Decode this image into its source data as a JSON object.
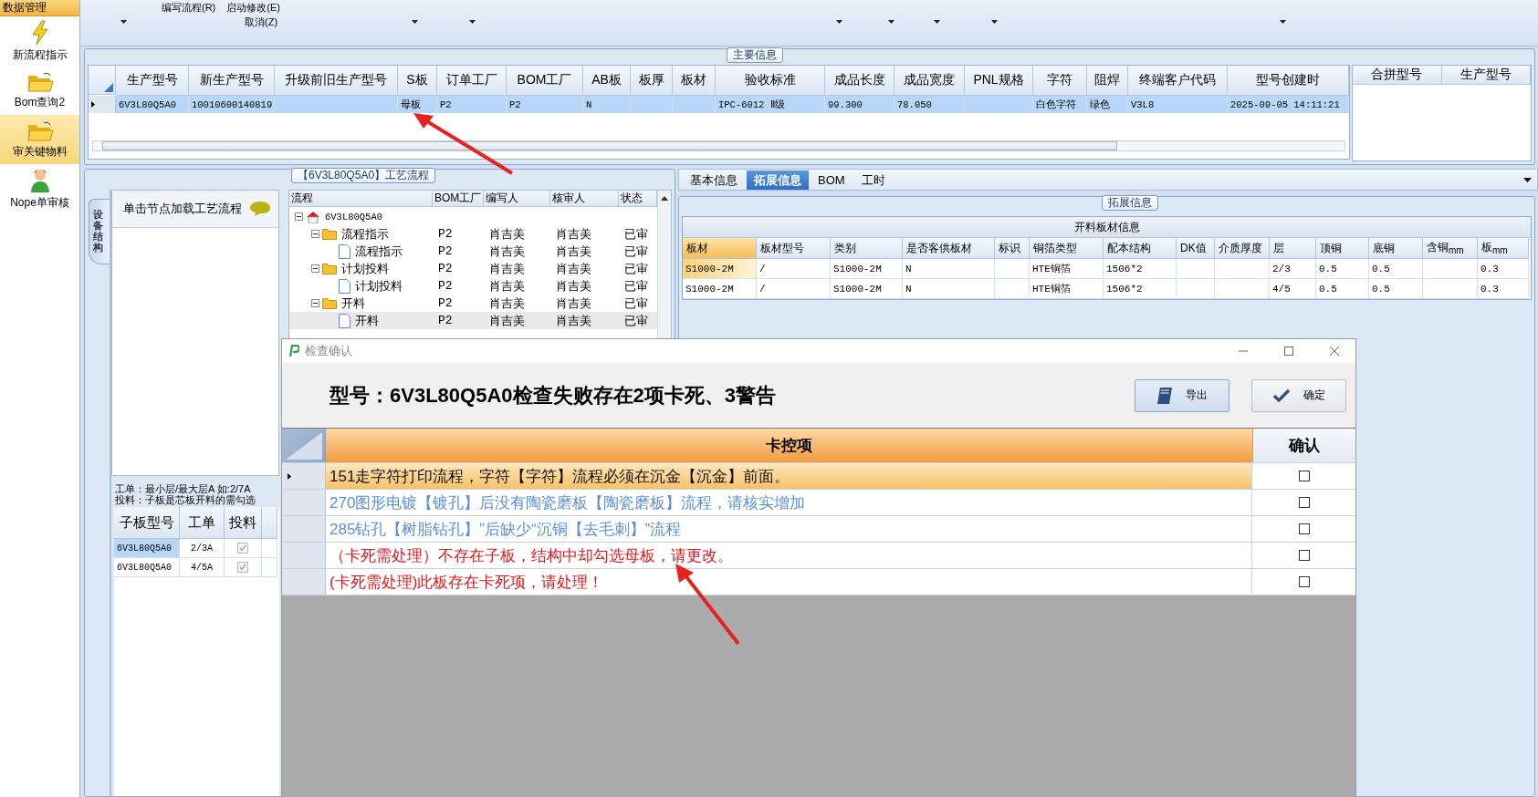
{
  "sidebar": {
    "header": "数据管理",
    "items": [
      {
        "label": "新流程指示",
        "kind": "lightning",
        "selected": false
      },
      {
        "label": "Bom查询2",
        "kind": "folder",
        "selected": false
      },
      {
        "label": "审关键物料",
        "kind": "folder",
        "selected": true
      },
      {
        "label": "Nope单审核",
        "kind": "person",
        "selected": false
      }
    ]
  },
  "ribbon": {
    "commands": [
      "编写流程(R)",
      "启动修改(E)",
      "取消(Z)"
    ]
  },
  "main_info": {
    "title": "主要信息",
    "columns": [
      "生产型号",
      "新生产型号",
      "升级前旧生产型号",
      "S板",
      "订单工厂",
      "BOM工厂",
      "AB板",
      "板厚",
      "板材",
      "验收标准",
      "成品长度",
      "成品宽度",
      "PNL规格",
      "字符",
      "阻焊",
      "终端客户代码",
      "型号创建时"
    ],
    "rows": [
      {
        "selected": true,
        "cells": [
          "6V3L80Q5A0",
          "10010600140819",
          null,
          "母板",
          "P2",
          "P2",
          "N",
          null,
          null,
          "IPC-6012 Ⅱ级",
          "99.300",
          "78.050",
          null,
          "白色字符",
          "绿色",
          "V3L8",
          "2025-09-05 14:11:21"
        ]
      }
    ],
    "side_columns": [
      "合拼型号",
      "生产型号"
    ]
  },
  "process": {
    "title": "【6V3L80Q5A0】工艺流程",
    "side_tab": "设备结构",
    "hint": "单击节点加载工艺流程",
    "columns": [
      "流程",
      "BOM工厂",
      "编写人",
      "核审人",
      "状态"
    ],
    "tree": [
      {
        "label": "6V3L80Q5A0",
        "kind": "root",
        "expanded": true,
        "selected": false,
        "children": [
          {
            "label": "流程指示",
            "kind": "folder",
            "expanded": true,
            "selected": false,
            "cells": [
              "P2",
              "肖吉美",
              "肖吉美",
              "已审"
            ],
            "children": [
              {
                "label": "流程指示",
                "kind": "doc",
                "selected": false,
                "cells": [
                  "P2",
                  "肖吉美",
                  "肖吉美",
                  "已审"
                ]
              }
            ]
          },
          {
            "label": "计划投料",
            "kind": "folder",
            "expanded": true,
            "selected": false,
            "cells": [
              "P2",
              "肖吉美",
              "肖吉美",
              "已审"
            ],
            "children": [
              {
                "label": "计划投料",
                "kind": "doc",
                "selected": false,
                "cells": [
                  "P2",
                  "肖吉美",
                  "肖吉美",
                  "已审"
                ]
              }
            ]
          },
          {
            "label": "开料",
            "kind": "folder",
            "expanded": true,
            "selected": false,
            "cells": [
              "P2",
              "肖吉美",
              "肖吉美",
              "已审"
            ],
            "children": [
              {
                "label": "开料",
                "kind": "doc",
                "selected": true,
                "cells": [
                  "P2",
                  "肖吉美",
                  "肖吉美",
                  "已审"
                ]
              }
            ]
          }
        ]
      }
    ],
    "notes": [
      "工单：最小层/最大层A 如:2/7A",
      "投料：子板是芯板开料的需勾选"
    ],
    "sub_boards": {
      "columns": [
        "子板型号",
        "工单",
        "投料"
      ],
      "rows": [
        {
          "selected": true,
          "cells": [
            "6V3L80Q5A0",
            "2/3A"
          ],
          "checked": true
        },
        {
          "selected": false,
          "cells": [
            "6V3L80Q5A0",
            "4/5A"
          ],
          "checked": true
        }
      ]
    }
  },
  "detail": {
    "tabs": [
      {
        "label": "基本信息",
        "selected": false
      },
      {
        "label": "拓展信息",
        "selected": true
      },
      {
        "label": "BOM",
        "selected": false
      },
      {
        "label": "工时",
        "selected": false
      }
    ],
    "group_title": "拓展信息",
    "caption": "开料板材信息",
    "columns": [
      "板材",
      "板材型号",
      "类别",
      "是否客供板材",
      "标识",
      "铜箔类型",
      "配本结构",
      "DK值",
      "介质厚度",
      "层",
      "顶铜",
      "底铜",
      "含铜$_{mm}$",
      "板$_{mm}$"
    ],
    "rows": [
      {
        "selected": true,
        "cells": [
          "S1000-2M",
          "/",
          "S1000-2M",
          "N",
          null,
          "HTE铜箔",
          "1506*2",
          null,
          null,
          "2/3",
          "0.5",
          "0.5",
          null,
          "0.3"
        ]
      },
      {
        "selected": false,
        "cells": [
          "S1000-2M",
          "/",
          "S1000-2M",
          "N",
          null,
          "HTE铜箔",
          "1506*2",
          null,
          null,
          "4/5",
          "0.5",
          "0.5",
          null,
          "0.3"
        ]
      }
    ]
  },
  "dialog": {
    "title": "检查确认",
    "heading": "型号：6V3L80Q5A0检查失败存在2项卡死、3警告",
    "buttons": [
      {
        "label": "导出",
        "kind": "export"
      },
      {
        "label": "确定",
        "kind": "ok"
      }
    ],
    "columns": [
      "卡控项",
      "确认"
    ],
    "rows": [
      {
        "text": "151走字符打印流程，字符【字符】流程必须在沉金【沉金】前面。",
        "kind": "normal",
        "selected": true,
        "checked": false
      },
      {
        "text": "270图形电镀【镀孔】后没有陶瓷磨板【陶瓷磨板】流程，请核实增加",
        "kind": "warning",
        "selected": false,
        "checked": false
      },
      {
        "text": "285钻孔【树脂钻孔】”后缺少“沉铜【去毛刺】”流程",
        "kind": "warning",
        "selected": false,
        "checked": false
      },
      {
        "text": "（卡死需处理）不存在子板，结构中却勾选母板，请更改。",
        "kind": "error",
        "selected": false,
        "checked": false
      },
      {
        "text": "(卡死需处理)此板存在卡死项，请处理！",
        "kind": "error",
        "selected": false,
        "checked": false
      }
    ]
  }
}
